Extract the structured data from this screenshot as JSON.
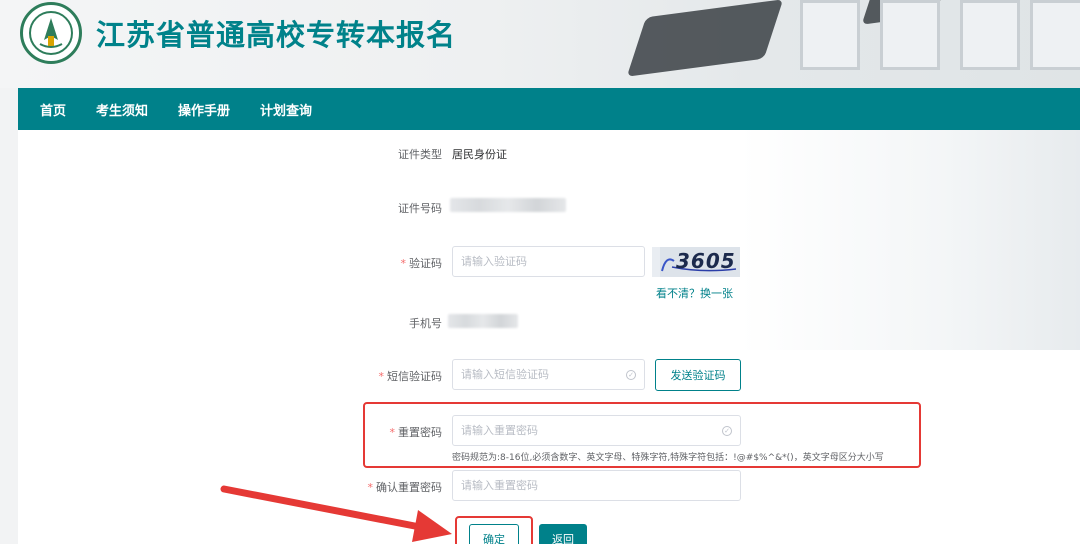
{
  "header": {
    "title": "江苏省普通高校专转本报名"
  },
  "nav": {
    "items": [
      "首页",
      "考生须知",
      "操作手册",
      "计划查询"
    ]
  },
  "form": {
    "id_type_label": "证件类型",
    "id_type_value": "居民身份证",
    "id_number_label": "证件号码",
    "captcha_label": "验证码",
    "captcha_placeholder": "请输入验证码",
    "captcha_image_text": "3605",
    "captcha_refresh": "看不清？换一张",
    "phone_label": "手机号",
    "sms_label": "短信验证码",
    "sms_placeholder": "请输入短信验证码",
    "sms_button": "发送验证码",
    "reset_label": "重置密码",
    "reset_placeholder": "请输入重置密码",
    "password_hint": "密码规范为:8-16位,必须含数字、英文字母、特殊字符,特殊字符包括：!@#$%^&*()，英文字母区分大小写",
    "confirm_label": "确认重置密码",
    "confirm_placeholder": "请输入重置密码",
    "confirm_button": "确定",
    "back_button": "返回"
  },
  "colors": {
    "brand": "#00818a",
    "required": "#f56c6c",
    "annotation": "#e53935"
  }
}
